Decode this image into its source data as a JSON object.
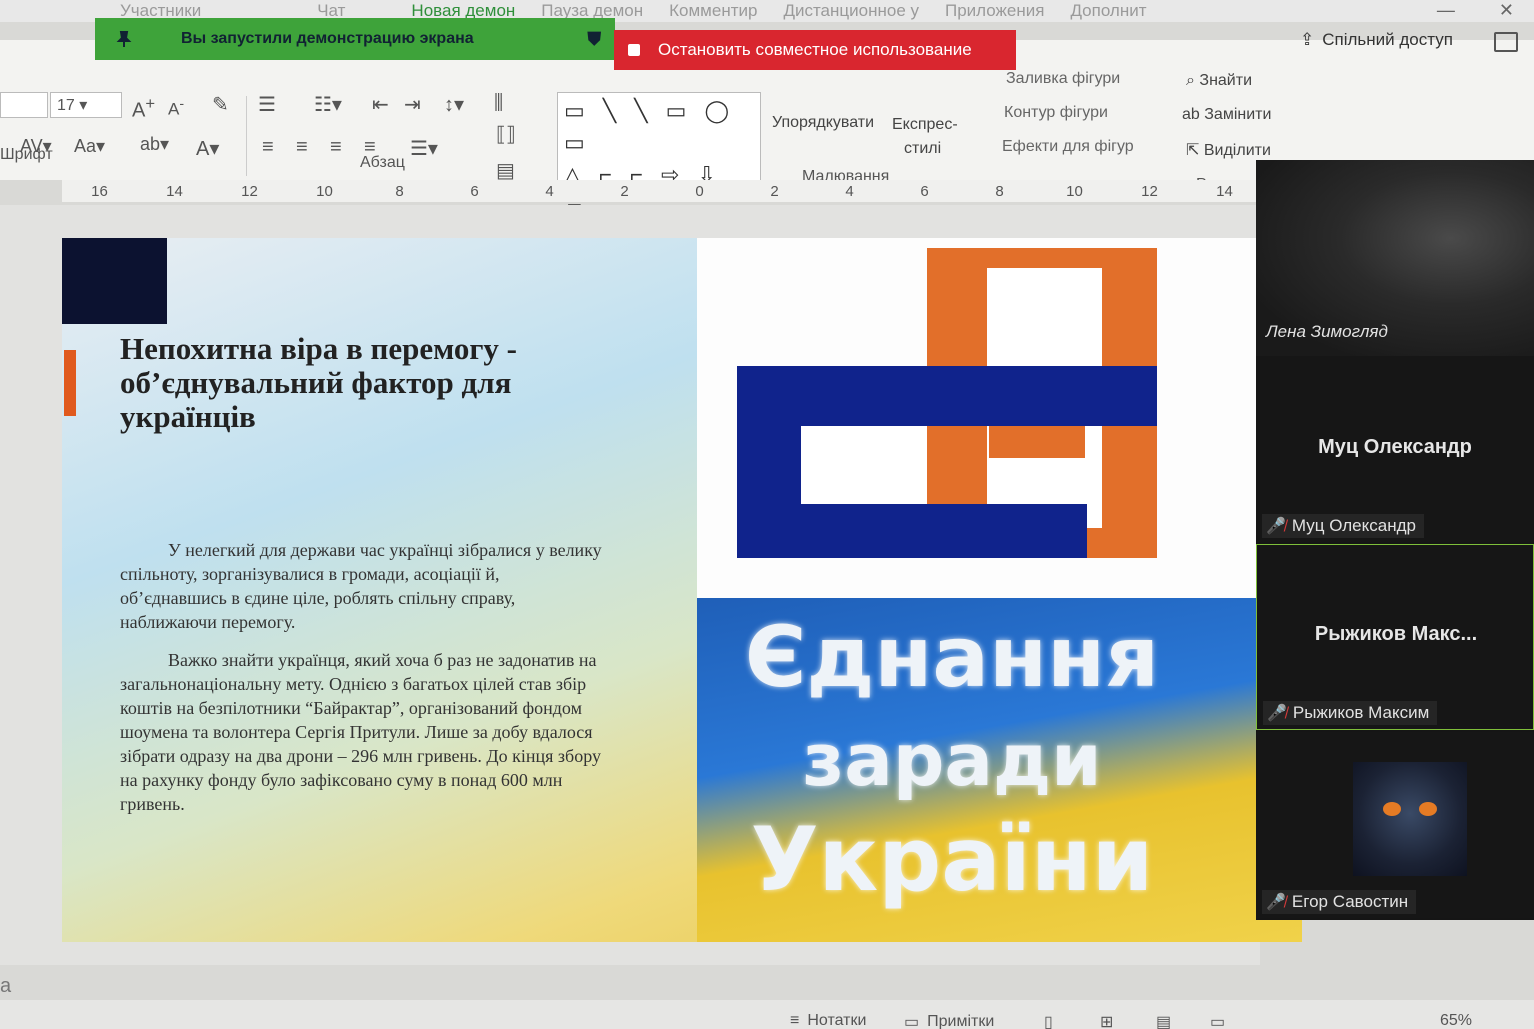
{
  "conference": {
    "menu": [
      "Участники",
      "Чат",
      "Новая демон",
      "Пауза демон",
      "Комментир",
      "Дистанционное у",
      "Приложения",
      "Дополнит"
    ],
    "share_banner": "Вы запустили демонстрацию экрана",
    "stop_sharing": "Остановить совместное использование"
  },
  "ribbon": {
    "share_access": "Спільний доступ",
    "font_size": "17",
    "groups": {
      "font": "Шрифт",
      "paragraph": "Абзац",
      "drawing": "Малювання",
      "editing": "Редагува"
    },
    "drawing": {
      "arrange": "Упорядкувати",
      "quick_styles_1": "Експрес-",
      "quick_styles_2": "стилі",
      "shape_fill": "Заливка фігури",
      "shape_outline": "Контур фігури",
      "shape_effects": "Ефекти для фігур"
    },
    "editing": {
      "find": "Знайти",
      "replace": "Замінити",
      "select": "Виділити"
    }
  },
  "ruler": [
    "16",
    "14",
    "12",
    "10",
    "8",
    "6",
    "4",
    "2",
    "0",
    "2",
    "4",
    "6",
    "8",
    "10",
    "12",
    "14"
  ],
  "slide": {
    "title": "Непохитна віра в перемогу - об’єднувальний фактор для українців",
    "paragraph_1": "У нелегкий для держави час українці зібралися у велику спільноту, зорганізувалися в громади, асоціації й, об’єднавшись в єдине ціле, роблять спільну справу, наближаючи перемогу.",
    "paragraph_2": "Важко знайти українця, який хоча б раз не задонатив на загальнонаціональну мету. Однією з багатьох цілей став збір коштів на безпілотники “Байрактар”, організований фондом шоумена та волонтера Сергія Притули. Лише за добу вдалося зібрати одразу на два дрони – 296 млн гривень. До кінця збору на рахунку фонду було зафіксовано суму в понад 600 млн гривень.",
    "banner_line1": "Єднання",
    "banner_line2": "заради",
    "banner_line3": "України"
  },
  "participants": [
    {
      "name": "Лена Зимогляд",
      "display": "",
      "muted": false
    },
    {
      "name": "Муц Олександр",
      "display": "Муц Олександр",
      "muted": true
    },
    {
      "name": "Рыжиков Максим",
      "display": "Рыжиков Макс...",
      "muted": true
    },
    {
      "name": "Егор Савостин",
      "display": "",
      "muted": true
    }
  ],
  "statusbar": {
    "notes": "Нотатки",
    "comments": "Примітки",
    "zoom": "65%",
    "left_fragment": "а"
  }
}
